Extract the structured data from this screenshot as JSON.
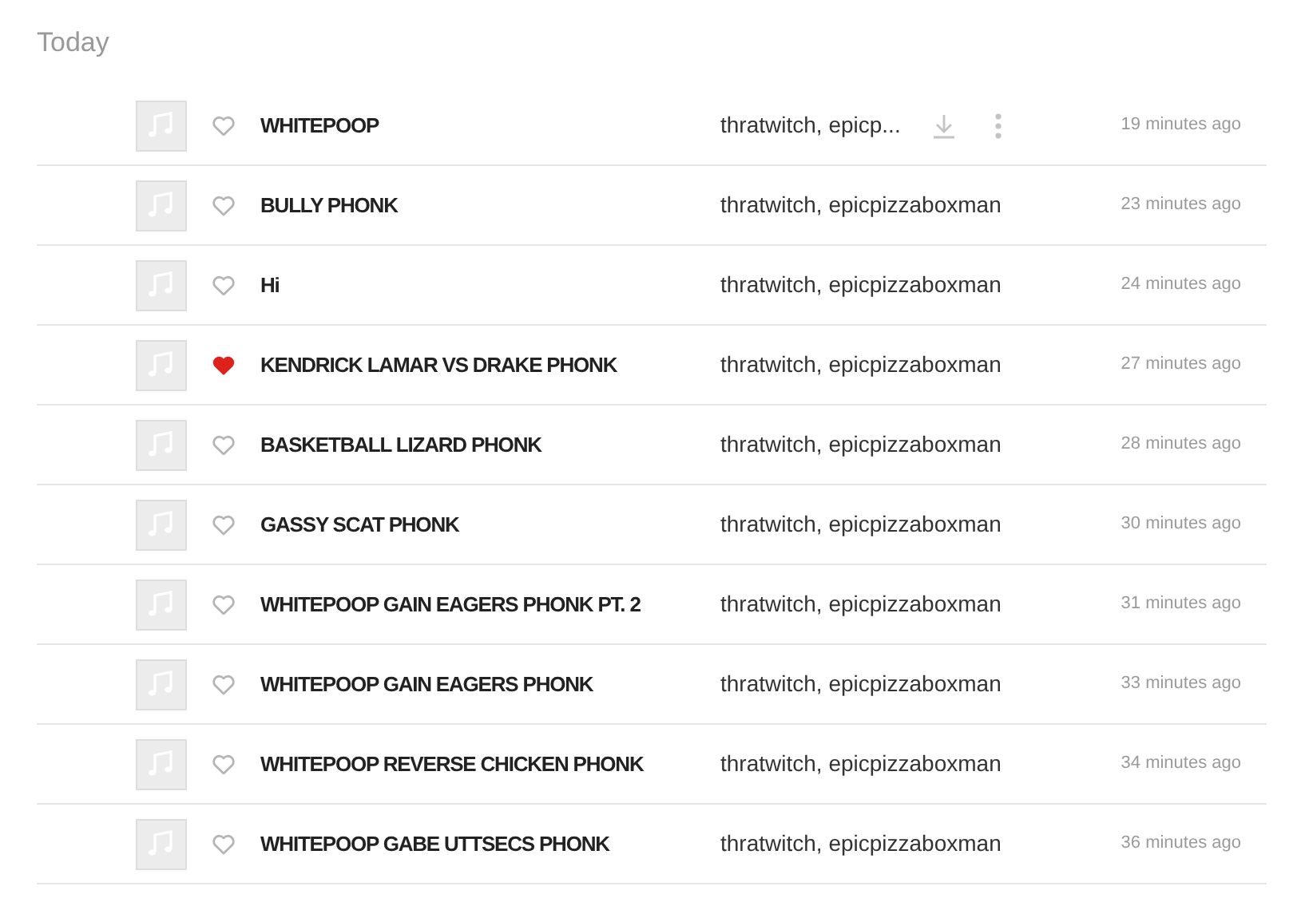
{
  "section_title": "Today",
  "tracks": [
    {
      "title": "WHITEPOOP",
      "artists": "thratwitch, epicp...",
      "time": "19 minutes ago",
      "liked": false,
      "hovered": true
    },
    {
      "title": "BULLY PHONK",
      "artists": "thratwitch, epicpizzaboxman",
      "time": "23 minutes ago",
      "liked": false,
      "hovered": false
    },
    {
      "title": "Hi",
      "artists": "thratwitch, epicpizzaboxman",
      "time": "24 minutes ago",
      "liked": false,
      "hovered": false
    },
    {
      "title": "KENDRICK LAMAR VS DRAKE PHONK",
      "artists": "thratwitch, epicpizzaboxman",
      "time": "27 minutes ago",
      "liked": true,
      "hovered": false
    },
    {
      "title": "BASKETBALL LIZARD PHONK",
      "artists": "thratwitch, epicpizzaboxman",
      "time": "28 minutes ago",
      "liked": false,
      "hovered": false
    },
    {
      "title": "GASSY SCAT PHONK",
      "artists": "thratwitch, epicpizzaboxman",
      "time": "30 minutes ago",
      "liked": false,
      "hovered": false
    },
    {
      "title": "WHITEPOOP GAIN EAGERS PHONK PT. 2",
      "artists": "thratwitch, epicpizzaboxman",
      "time": "31 minutes ago",
      "liked": false,
      "hovered": false
    },
    {
      "title": "WHITEPOOP GAIN EAGERS PHONK",
      "artists": "thratwitch, epicpizzaboxman",
      "time": "33 minutes ago",
      "liked": false,
      "hovered": false
    },
    {
      "title": "WHITEPOOP REVERSE CHICKEN PHONK",
      "artists": "thratwitch, epicpizzaboxman",
      "time": "34 minutes ago",
      "liked": false,
      "hovered": false
    },
    {
      "title": "WHITEPOOP GABE UTTSECS PHONK",
      "artists": "thratwitch, epicpizzaboxman",
      "time": "36 minutes ago",
      "liked": false,
      "hovered": false
    }
  ]
}
